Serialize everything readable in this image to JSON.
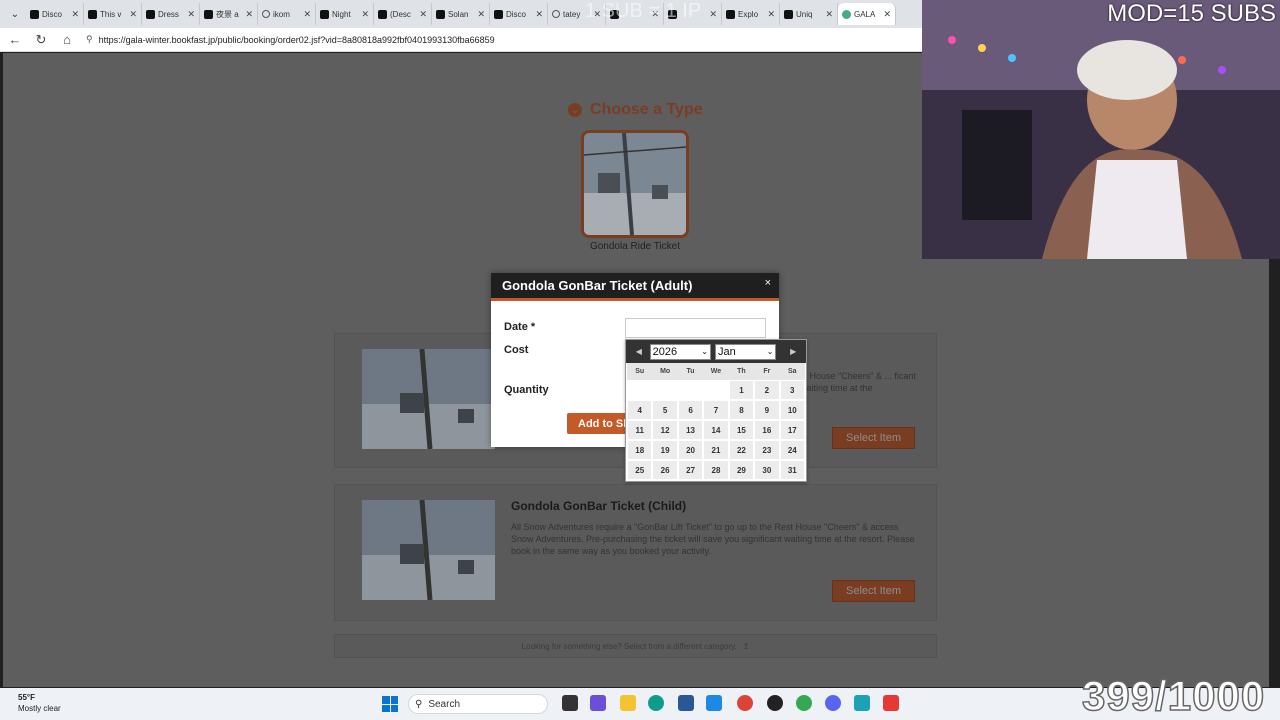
{
  "browser": {
    "tabs": [
      {
        "label": "Disco",
        "icon": "tiktok-icon"
      },
      {
        "label": "This v",
        "icon": "tiktok-icon"
      },
      {
        "label": "Dress",
        "icon": "tiktok-icon"
      },
      {
        "label": "夜景 a",
        "icon": "tiktok-icon"
      },
      {
        "label": "ikom",
        "icon": "search-icon"
      },
      {
        "label": "Night",
        "icon": "tiktok-icon"
      },
      {
        "label": "(Desc",
        "icon": "tiktok-icon"
      },
      {
        "label": "Solan",
        "icon": "tiktok-icon"
      },
      {
        "label": "Disco",
        "icon": "tiktok-icon"
      },
      {
        "label": "tatey",
        "icon": "search-icon"
      },
      {
        "label": "",
        "icon": "tiktok-icon"
      },
      {
        "label": "",
        "icon": "tiktok-icon"
      },
      {
        "label": "Explo",
        "icon": "tiktok-icon"
      },
      {
        "label": "Uniq",
        "icon": "tiktok-icon"
      },
      {
        "label": "GALA",
        "icon": "gala-icon"
      }
    ],
    "url": "https://gala-winter.bookfast.jp/public/booking/order02.jsf?vid=8a80818a992fbf0401993130fba66859"
  },
  "overlay": {
    "sub_banner": "1 SUB = 1 IP",
    "mod_banner": "MOD=15 SUBS",
    "counter": "399/1000"
  },
  "page": {
    "section_title": "Choose a Type",
    "type_label": "Gondola Ride Ticket",
    "cards": [
      {
        "title": "",
        "desc": "ld House \"Cheers\" & ... ficant waiting time at the",
        "button": "Select Item"
      },
      {
        "title": "Gondola GonBar Ticket (Child)",
        "desc": "All Snow Adventures require a \"GonBar Lift Ticket\" to go up to the Rest House \"Cheers\" & access Snow Adventures. Pre-purchasing the ticket will save you significant waiting time at the resort. Please book in the same way as you booked your activity.",
        "button": "Select Item"
      }
    ],
    "footer_note": "Looking for something else? Select from a different category."
  },
  "modal": {
    "title": "Gondola GonBar Ticket (Adult)",
    "close": "×",
    "date_label": "Date *",
    "cost_label": "Cost",
    "quantity_label": "Quantity",
    "add_button": "Add to Sh"
  },
  "datepicker": {
    "year": "2026",
    "month": "Jan",
    "weekdays": [
      "Su",
      "Mo",
      "Tu",
      "We",
      "Th",
      "Fr",
      "Sa"
    ],
    "leading_blanks": 4,
    "days": 31
  },
  "taskbar": {
    "temp": "55°F",
    "weather": "Mostly clear",
    "search_placeholder": "Search"
  },
  "colors": {
    "accent": "#c35a27",
    "accent_dim": "#7a3d22",
    "modal_header": "#1f1f1f"
  }
}
